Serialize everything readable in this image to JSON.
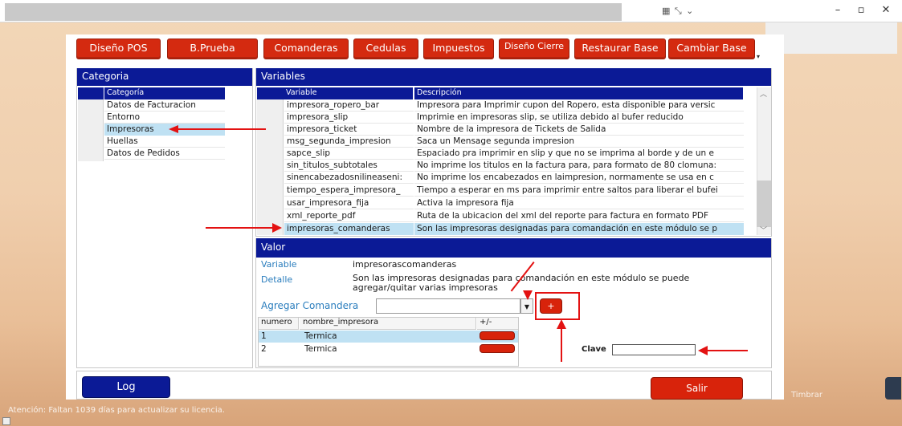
{
  "window": {
    "minimize": "–",
    "maximize": "▫",
    "close": "✕"
  },
  "tabs": [
    {
      "label": "Diseño POS"
    },
    {
      "label": "B.Prueba"
    },
    {
      "label": "Comanderas"
    },
    {
      "label": "Cedulas"
    },
    {
      "label": "Impuestos"
    },
    {
      "label": "Diseño Cierre"
    },
    {
      "label": "Restaurar Base"
    },
    {
      "label": "Cambiar Base"
    }
  ],
  "categoria": {
    "title": "Categoria",
    "column": "Categoría",
    "items": [
      "Datos de Facturacion",
      "Entorno",
      "Impresoras",
      "Huellas",
      "Datos de Pedidos"
    ]
  },
  "variables": {
    "title": "Variables",
    "col_variable": "Variable",
    "col_descripcion": "Descripción",
    "rows": [
      {
        "variable": "impresora_ropero_bar",
        "descripcion": "Impresora para Imprimir cupon del Ropero, esta disponible para versic"
      },
      {
        "variable": "impresora_slip",
        "descripcion": "Imprimie en impresoras slip, se utiliza debido al bufer reducido"
      },
      {
        "variable": "impresora_ticket",
        "descripcion": "Nombre de la impresora de Tickets de Salida"
      },
      {
        "variable": "msg_segunda_impresion",
        "descripcion": "Saca un Mensage segunda impresion"
      },
      {
        "variable": "sapce_slip",
        "descripcion": "Espaciado pra imprimir en slip y que no se imprima al borde y de un e"
      },
      {
        "variable": "sin_titulos_subtotales",
        "descripcion": "No imprime los titulos en la factura para, para formato de 80 clomuna:"
      },
      {
        "variable": "sinencabezadosnilineaseni:",
        "descripcion": "No imprime los encabezados en laimpresion, normamente se usa en c"
      },
      {
        "variable": "tiempo_espera_impresora_",
        "descripcion": "Tiempo a esperar en ms para imprimir entre saltos para liberar el bufei"
      },
      {
        "variable": "usar_impresora_fija",
        "descripcion": "Activa la impresora fija"
      },
      {
        "variable": "xml_reporte_pdf",
        "descripcion": "Ruta de la ubicacion del xml del reporte para factura en formato PDF"
      },
      {
        "variable": "impresoras_comanderas",
        "descripcion": "Son las impresoras designadas para comandación en este módulo se p"
      }
    ]
  },
  "valor": {
    "title": "Valor",
    "variable_label": "Variable",
    "variable_value": "impresorascomanderas",
    "detalle_label": "Detalle",
    "detalle_value": "Son las impresoras designadas para comandación en este módulo se puede agregar/quitar varias impresoras",
    "agregar_label": "Agregar Comandera",
    "agregar_value": "",
    "add_symbol": "+",
    "clave_label": "Clave",
    "clave_value": ""
  },
  "comanderas_grid": {
    "col_numero": "numero",
    "col_nombre": "nombre_impresora",
    "col_action": "+/-",
    "rows": [
      {
        "numero": "1",
        "nombre": "Termica"
      },
      {
        "numero": "2",
        "nombre": "Termica"
      }
    ]
  },
  "buttons": {
    "log": "Log",
    "salir": "Salir"
  },
  "status": {
    "license": "Atención: Faltan 1039 días para actualizar su licencia.",
    "timbrar": "Timbrar"
  },
  "colors": {
    "accent_red": "#d8230b",
    "header_blue": "#0b1a96",
    "selection": "#bfe1f3",
    "annotation": "#e31212"
  }
}
